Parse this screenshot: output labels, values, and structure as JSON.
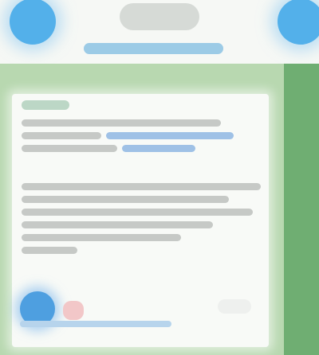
{
  "colors": {
    "top_bar": "#f6f8f5",
    "round_button": "#53b0ea",
    "title_pill": "#d6dad6",
    "subtitle_bar": "#9ccbe6",
    "content_background": "#b8d8b0",
    "right_strip": "#6fae72",
    "card": "#f8faf7",
    "text_placeholder": "#c6c9c6",
    "link_placeholder": "#9fc1e6",
    "pink_badge": "#f2c7c8"
  },
  "icons": {
    "left_button": "circle-button-icon",
    "right_button": "circle-button-icon",
    "reaction": "reaction-icon"
  }
}
